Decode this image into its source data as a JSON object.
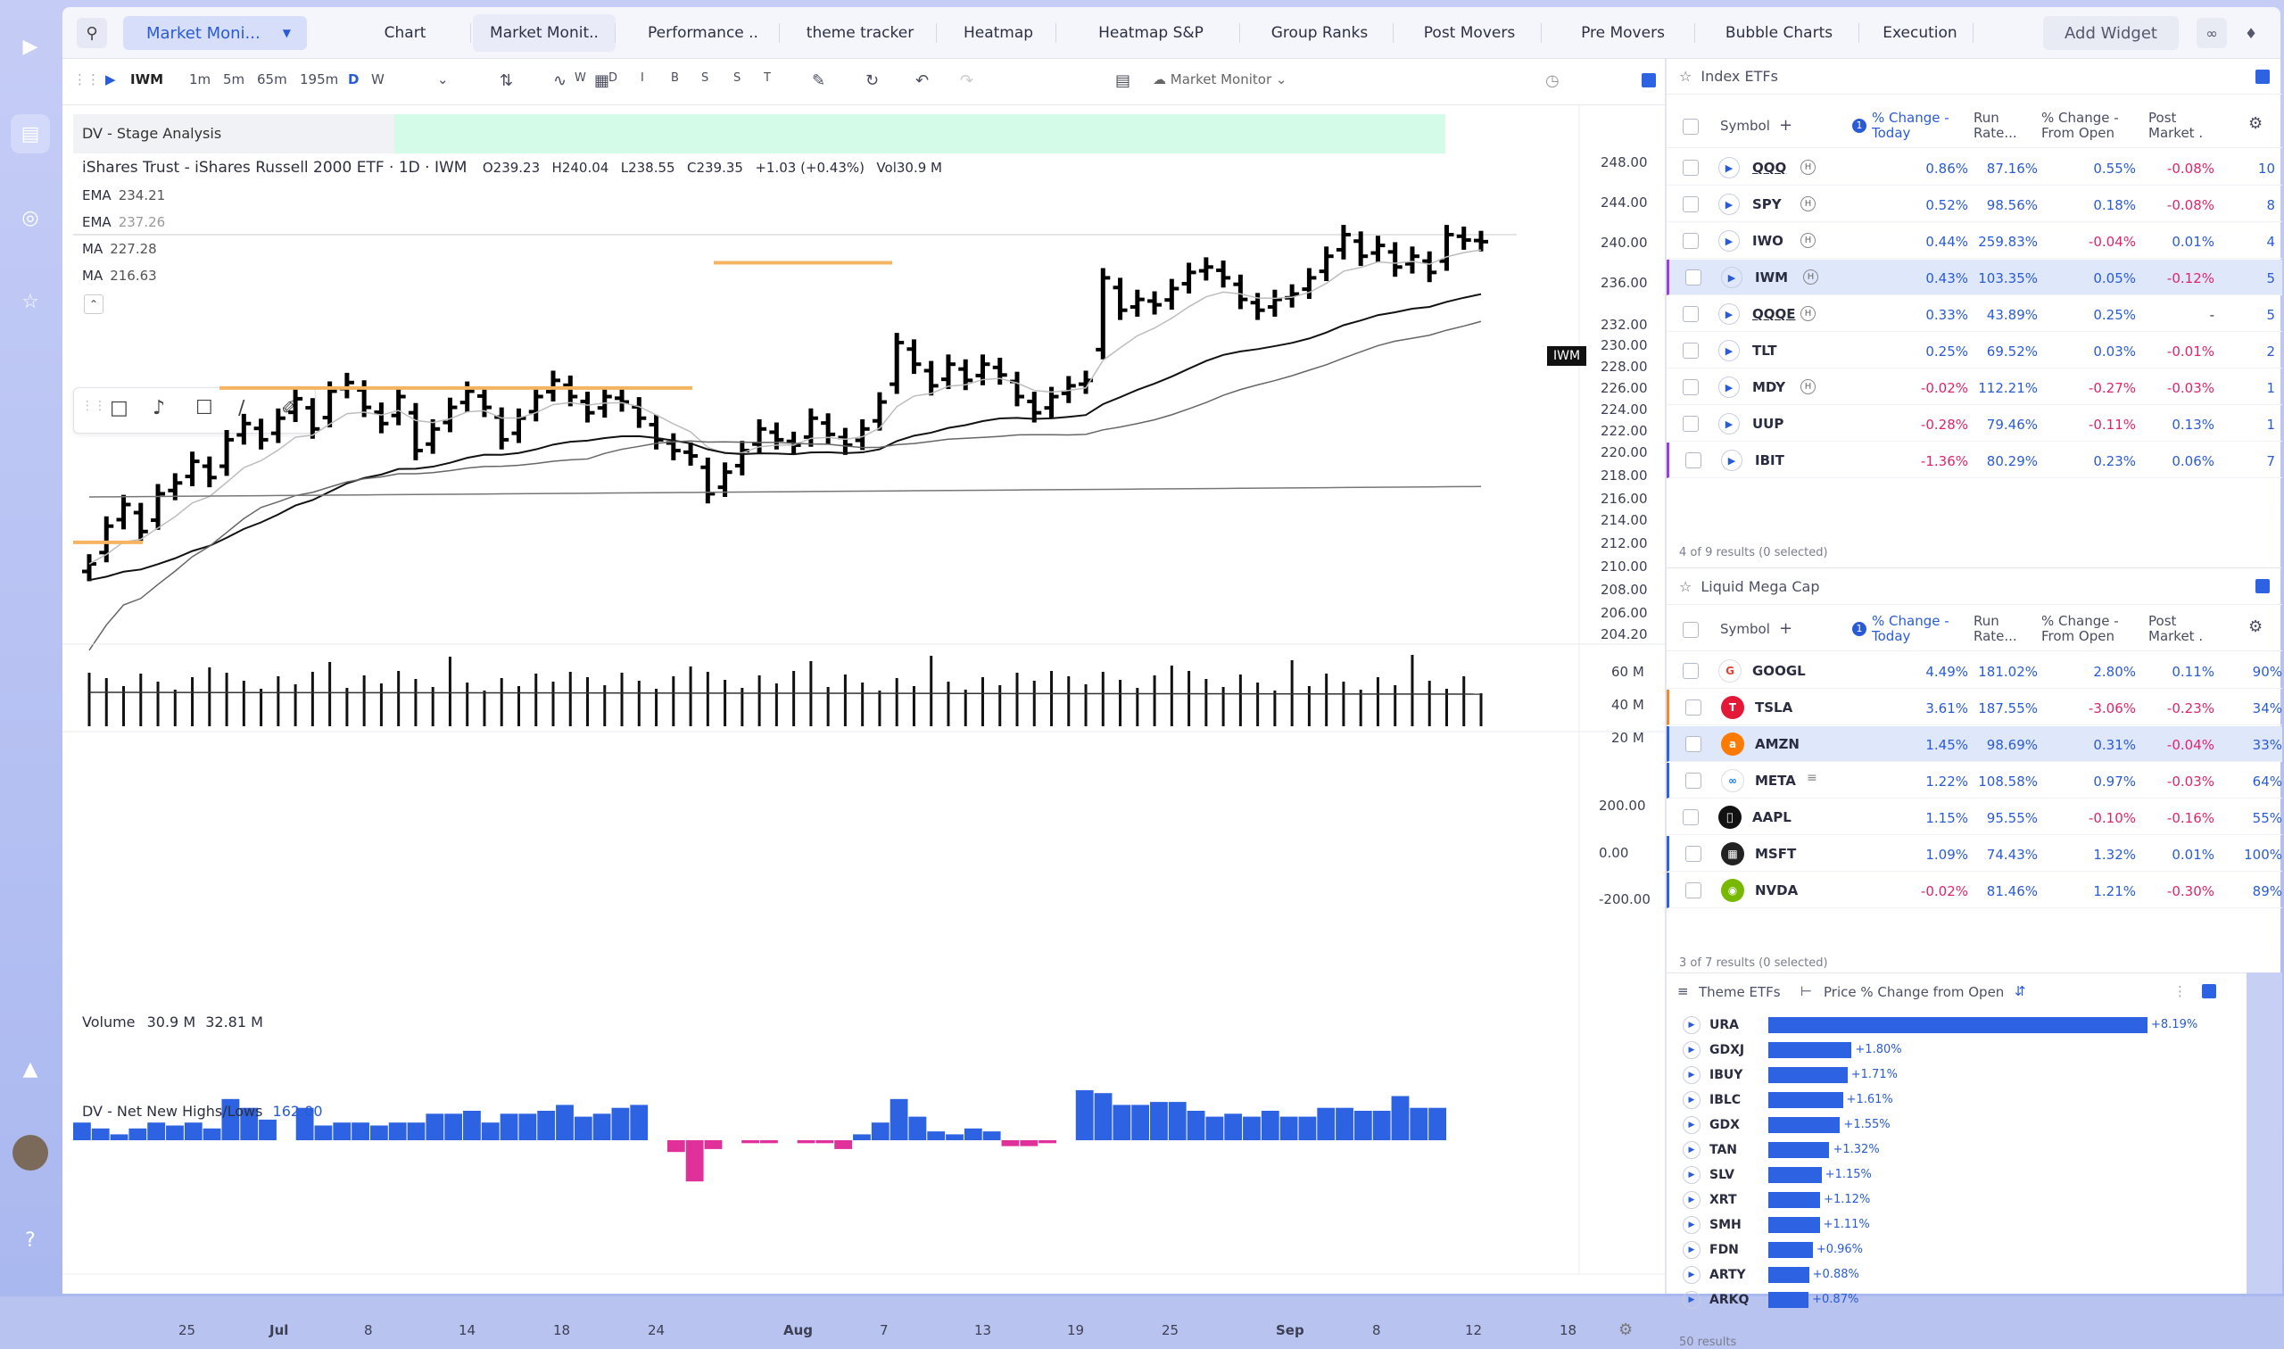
{
  "tabs": [
    "Chart",
    "Market Monit..",
    "Performance ..",
    "theme tracker",
    "Heatmap",
    "Heatmap S&P",
    "Group Ranks",
    "Post Movers",
    "Pre Movers",
    "Bubble Charts",
    "Execution"
  ],
  "workspace_selector": "Market Moni...",
  "add_widget": "Add Widget",
  "toolbar": {
    "symbol": "IWM",
    "intervals": [
      "1m",
      "5m",
      "65m",
      "195m",
      "D",
      "W"
    ],
    "letters": [
      "W",
      "D",
      "I",
      "B",
      "S",
      "S",
      "T"
    ],
    "layout_name": "Market Monitor"
  },
  "stage_label": "DV - Stage Analysis",
  "chart_title": "iShares Trust - iShares Russell 2000 ETF · 1D · IWM",
  "ohlc": {
    "o": "O239.23",
    "h": "H240.04",
    "l": "L238.55",
    "c": "C239.35",
    "chg": "+1.03 (+0.43%)",
    "vol": "Vol30.9 M"
  },
  "indicators": [
    {
      "name": "EMA",
      "value": "234.21"
    },
    {
      "name": "EMA",
      "value": "237.26"
    },
    {
      "name": "MA",
      "value": "227.28"
    },
    {
      "name": "MA",
      "value": "216.63"
    }
  ],
  "symbol_tag": "IWM",
  "volume_label": "Volume",
  "volume_values": [
    "30.9 M",
    "32.81 M"
  ],
  "nnhl_label": "DV - Net New Highs/Lows",
  "nnhl_value": "162.00",
  "price_axis": [
    "248.00",
    "244.00",
    "240.00",
    "236.00",
    "232.00",
    "230.00",
    "228.00",
    "226.00",
    "224.00",
    "222.00",
    "220.00",
    "218.00",
    "216.00",
    "214.00",
    "212.00",
    "210.00",
    "208.00",
    "206.00",
    "204.20"
  ],
  "vol_axis": [
    "60 M",
    "40 M",
    "20 M"
  ],
  "nnhl_axis": [
    "200.00",
    "0.00",
    "-200.00"
  ],
  "x_axis": [
    "25",
    "Jul",
    "8",
    "14",
    "18",
    "24",
    "Aug",
    "7",
    "13",
    "19",
    "25",
    "Sep",
    "8",
    "12",
    "18"
  ],
  "index_etfs": {
    "title": "Index ETFs",
    "columns": [
      "Symbol",
      "% Change - Today",
      "Run Rate...",
      "% Change - From Open",
      "Post Market ."
    ],
    "rows": [
      {
        "sym": "QQQ",
        "chg": "0.86%",
        "run": "87.16%",
        "open": "0.55%",
        "post": "-0.08%",
        "extra": "10"
      },
      {
        "sym": "SPY",
        "chg": "0.52%",
        "run": "98.56%",
        "open": "0.18%",
        "post": "-0.08%",
        "extra": "8"
      },
      {
        "sym": "IWO",
        "chg": "0.44%",
        "run": "259.83%",
        "open": "-0.04%",
        "post": "0.01%",
        "extra": "4"
      },
      {
        "sym": "IWM",
        "chg": "0.43%",
        "run": "103.35%",
        "open": "0.05%",
        "post": "-0.12%",
        "extra": "5"
      },
      {
        "sym": "QQQE",
        "chg": "0.33%",
        "run": "43.89%",
        "open": "0.25%",
        "post": "-",
        "extra": "5"
      },
      {
        "sym": "TLT",
        "chg": "0.25%",
        "run": "69.52%",
        "open": "0.03%",
        "post": "-0.01%",
        "extra": "2"
      },
      {
        "sym": "MDY",
        "chg": "-0.02%",
        "run": "112.21%",
        "open": "-0.27%",
        "post": "-0.03%",
        "extra": "1"
      },
      {
        "sym": "UUP",
        "chg": "-0.28%",
        "run": "79.46%",
        "open": "-0.11%",
        "post": "0.13%",
        "extra": "1"
      },
      {
        "sym": "IBIT",
        "chg": "-1.36%",
        "run": "80.29%",
        "open": "0.23%",
        "post": "0.06%",
        "extra": "7"
      }
    ],
    "footer": "4 of 9 results (0 selected)"
  },
  "mega_cap": {
    "title": "Liquid Mega Cap",
    "columns": [
      "Symbol",
      "% Change - Today",
      "Run Rate...",
      "% Change - From Open",
      "Post Market ."
    ],
    "rows": [
      {
        "sym": "GOOGL",
        "chg": "4.49%",
        "run": "181.02%",
        "open": "2.80%",
        "post": "0.11%",
        "extra": "90%",
        "logo": "#ffffff",
        "lc": "#e94235",
        "glyph": "G"
      },
      {
        "sym": "TSLA",
        "chg": "3.61%",
        "run": "187.55%",
        "open": "-3.06%",
        "post": "-0.23%",
        "extra": "34%",
        "logo": "#e31937",
        "lc": "#fff",
        "glyph": "T"
      },
      {
        "sym": "AMZN",
        "chg": "1.45%",
        "run": "98.69%",
        "open": "0.31%",
        "post": "-0.04%",
        "extra": "33%",
        "logo": "#ff7a00",
        "lc": "#fff",
        "glyph": "a"
      },
      {
        "sym": "META",
        "chg": "1.22%",
        "run": "108.58%",
        "open": "0.97%",
        "post": "-0.03%",
        "extra": "64%",
        "logo": "#ffffff",
        "lc": "#1877f2",
        "glyph": "∞"
      },
      {
        "sym": "AAPL",
        "chg": "1.15%",
        "run": "95.55%",
        "open": "-0.10%",
        "post": "-0.16%",
        "extra": "55%",
        "logo": "#111111",
        "lc": "#fff",
        "glyph": ""
      },
      {
        "sym": "MSFT",
        "chg": "1.09%",
        "run": "74.43%",
        "open": "1.32%",
        "post": "0.01%",
        "extra": "100%",
        "logo": "#222",
        "lc": "#fff",
        "glyph": "▦"
      },
      {
        "sym": "NVDA",
        "chg": "-0.02%",
        "run": "81.46%",
        "open": "1.21%",
        "post": "-0.30%",
        "extra": "89%",
        "logo": "#76b900",
        "lc": "#fff",
        "glyph": "◉"
      }
    ],
    "footer": "3 of 7 results (0 selected)"
  },
  "theme_etfs": {
    "title": "Theme ETFs",
    "metric": "Price % Change from Open",
    "rows": [
      {
        "sym": "URA",
        "pct": 8.19,
        "label": "+8.19%"
      },
      {
        "sym": "GDXJ",
        "pct": 1.8,
        "label": "+1.80%"
      },
      {
        "sym": "IBUY",
        "pct": 1.71,
        "label": "+1.71%"
      },
      {
        "sym": "IBLC",
        "pct": 1.61,
        "label": "+1.61%"
      },
      {
        "sym": "GDX",
        "pct": 1.55,
        "label": "+1.55%"
      },
      {
        "sym": "TAN",
        "pct": 1.32,
        "label": "+1.32%"
      },
      {
        "sym": "SLV",
        "pct": 1.15,
        "label": "+1.15%"
      },
      {
        "sym": "XRT",
        "pct": 1.12,
        "label": "+1.12%"
      },
      {
        "sym": "SMH",
        "pct": 1.11,
        "label": "+1.11%"
      },
      {
        "sym": "FDN",
        "pct": 0.96,
        "label": "+0.96%"
      },
      {
        "sym": "ARTY",
        "pct": 0.88,
        "label": "+0.88%"
      },
      {
        "sym": "ARKQ",
        "pct": 0.87,
        "label": "+0.87%"
      }
    ],
    "footer": "50 results"
  },
  "colors": {
    "accent": "#2a5bd7",
    "neg": "#e0246b",
    "pos_bar": "#2d63e3",
    "neg_bar": "#e0309a",
    "level": "#f5b461",
    "stage": "#d3fbe8"
  }
}
